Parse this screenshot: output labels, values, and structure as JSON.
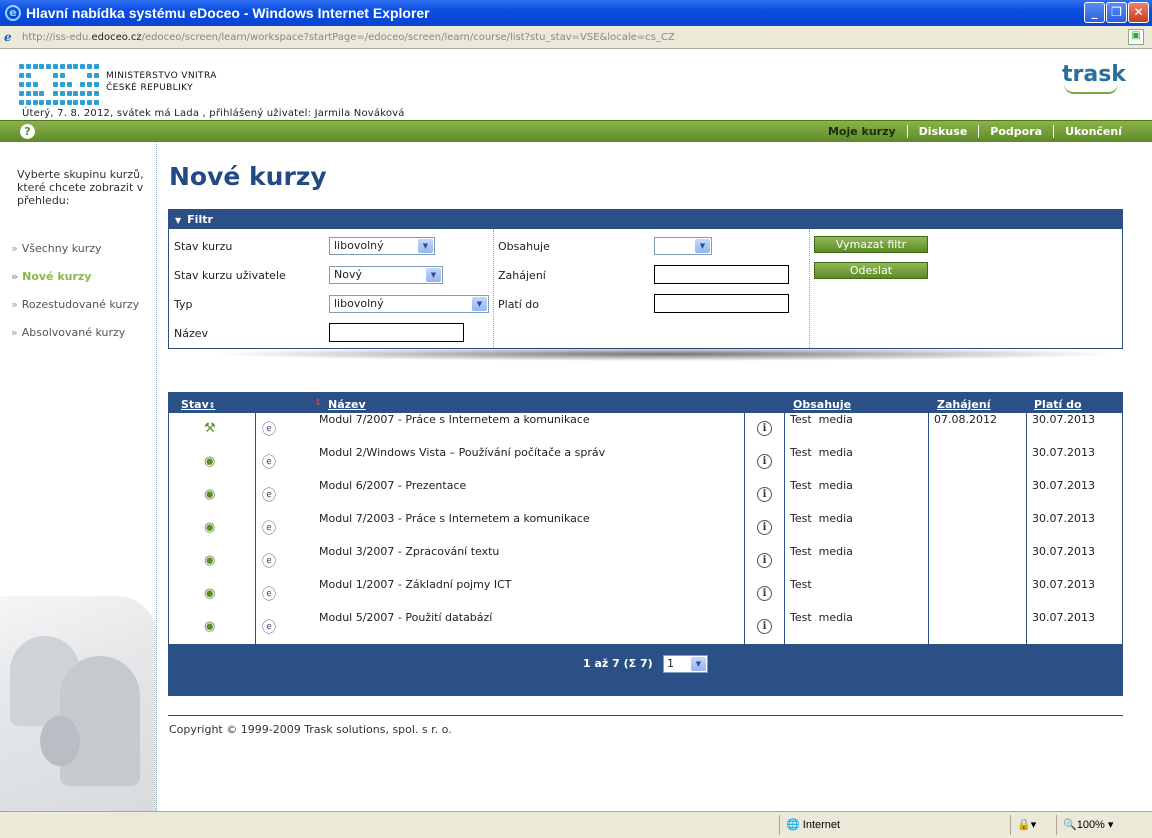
{
  "browser": {
    "title": "Hlavní nabídka systému eDoceo - Windows Internet Explorer",
    "url_prefix": "http://iss-edu.",
    "url_domain": "edoceo.cz",
    "url_suffix": "/edoceo/screen/learn/workspace?startPage=/edoceo/screen/learn/course/list?stu_stav=VSE&locale=cs_CZ",
    "status_zone": "Internet",
    "zoom": "100%"
  },
  "header": {
    "ministry_line1": "MINISTERSTVO VNITRA",
    "ministry_line2": "ČESKÉ REPUBLIKY",
    "brand": "trask",
    "info": "Úterý, 7. 8. 2012, svátek má Lada , přihlášený uživatel: Jarmila Nováková"
  },
  "topnav": [
    "Moje kurzy",
    "Diskuse",
    "Podpora",
    "Ukončení"
  ],
  "sidebar": {
    "intro": "Vyberte skupinu kurzů, které chcete zobrazit v přehledu:",
    "items": [
      "Všechny kurzy",
      "Nové kurzy",
      "Rozestudované kurzy",
      "Absolvované kurzy"
    ],
    "active_index": 1
  },
  "page_title": "Nové kurzy",
  "filter": {
    "title": "Filtr",
    "stav_kurzu_label": "Stav kurzu",
    "stav_kurzu_value": "libovolný",
    "stav_uzivatele_label": "Stav kurzu uživatele",
    "stav_uzivatele_value": "Nový",
    "typ_label": "Typ",
    "typ_value": "libovolný",
    "nazev_label": "Název",
    "nazev_value": "",
    "obsahuje_label": "Obsahuje",
    "obsahuje_value": "",
    "zahajeni_label": "Zahájení",
    "zahajeni_value": "",
    "plati_label": "Platí do",
    "plati_value": "",
    "clear_button": "Vymazat filtr",
    "submit_button": "Odeslat"
  },
  "table": {
    "columns": [
      "Stav",
      "Název",
      "Obsahuje",
      "Zahájení",
      "Platí do"
    ],
    "rows": [
      {
        "status_icon": "tools-icon",
        "name": "Modul 7/2007 - Práce s Internetem a komunikace",
        "contains": "Test  media",
        "start": "07.08.2012",
        "valid": "30.07.2013"
      },
      {
        "status_icon": "eye-icon",
        "name": "Modul 2/Windows Vista – Používání počítače a správ",
        "contains": "Test  media",
        "start": "",
        "valid": "30.07.2013"
      },
      {
        "status_icon": "eye-icon",
        "name": "Modul 6/2007 - Prezentace",
        "contains": "Test  media",
        "start": "",
        "valid": "30.07.2013"
      },
      {
        "status_icon": "eye-icon",
        "name": "Modul 7/2003 - Práce s Internetem a komunikace",
        "contains": "Test  media",
        "start": "",
        "valid": "30.07.2013"
      },
      {
        "status_icon": "eye-icon",
        "name": "Modul 3/2007 - Zpracování textu",
        "contains": "Test  media",
        "start": "",
        "valid": "30.07.2013"
      },
      {
        "status_icon": "eye-icon",
        "name": "Modul 1/2007 - Základní pojmy ICT",
        "contains": "Test",
        "start": "",
        "valid": "30.07.2013"
      },
      {
        "status_icon": "eye-icon",
        "name": "Modul 5/2007 - Použití databází",
        "contains": "Test  media",
        "start": "",
        "valid": "30.07.2013"
      }
    ],
    "pager_text": "1 až 7 (Σ 7)",
    "pager_page": "1"
  },
  "footer": {
    "copyright": "Copyright © 1999-2009 Trask solutions, spol. s r. o."
  },
  "colors": {
    "accent_blue": "#2a5085",
    "accent_green": "#5d8a26",
    "title_blue": "#244a86"
  }
}
